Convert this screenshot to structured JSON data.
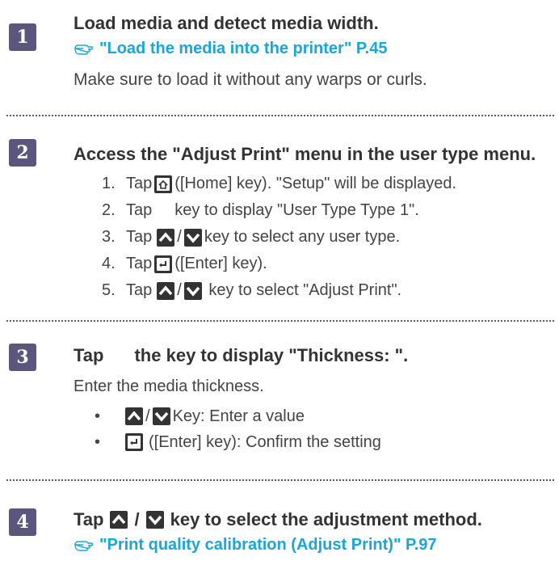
{
  "steps": [
    {
      "number": "1",
      "title": "Load media and detect media width.",
      "link": "\"Load the media into the printer\" P.45",
      "body": "Make sure to load it without any warps or curls."
    },
    {
      "number": "2",
      "title": "Access the \"Adjust Print\" menu in the user type menu.",
      "items": [
        {
          "num": "1.",
          "before": "Tap",
          "icons": [
            "home-key-icon"
          ],
          "after": "([Home] key). \"Setup\" will be displayed."
        },
        {
          "num": "2.",
          "before": "Tap",
          "icons": [
            "right-key-icon"
          ],
          "after": "key to display \"User Type   Type 1\"."
        },
        {
          "num": "3.",
          "before": "Tap",
          "icons": [
            "up-key-icon",
            "down-key-icon"
          ],
          "after": "key to select any user type."
        },
        {
          "num": "4.",
          "before": "Tap",
          "icons": [
            "enter-key-icon"
          ],
          "after": "([Enter] key)."
        },
        {
          "num": "5.",
          "before": "Tap",
          "icons": [
            "up-key-icon",
            "down-key-icon"
          ],
          "after": " key to select \"Adjust Print\"."
        }
      ]
    },
    {
      "number": "3",
      "title_before": "Tap",
      "title_after": "the key to display \"Thickness: \".",
      "body": "Enter the media thickness.",
      "bullets": [
        {
          "bullet": "•",
          "text": "Key: Enter a value"
        },
        {
          "bullet": "•",
          "text": "([Enter] key): Confirm the setting"
        }
      ]
    },
    {
      "number": "4",
      "title_before": "Tap",
      "title_after": "key to select the adjustment method.",
      "link": "\"Print quality calibration (Adjust Print)\" P.97"
    }
  ],
  "separators": {
    "slash": "/"
  },
  "colors": {
    "badge": "#5a567e",
    "link": "#19a6da",
    "text": "#444444"
  }
}
